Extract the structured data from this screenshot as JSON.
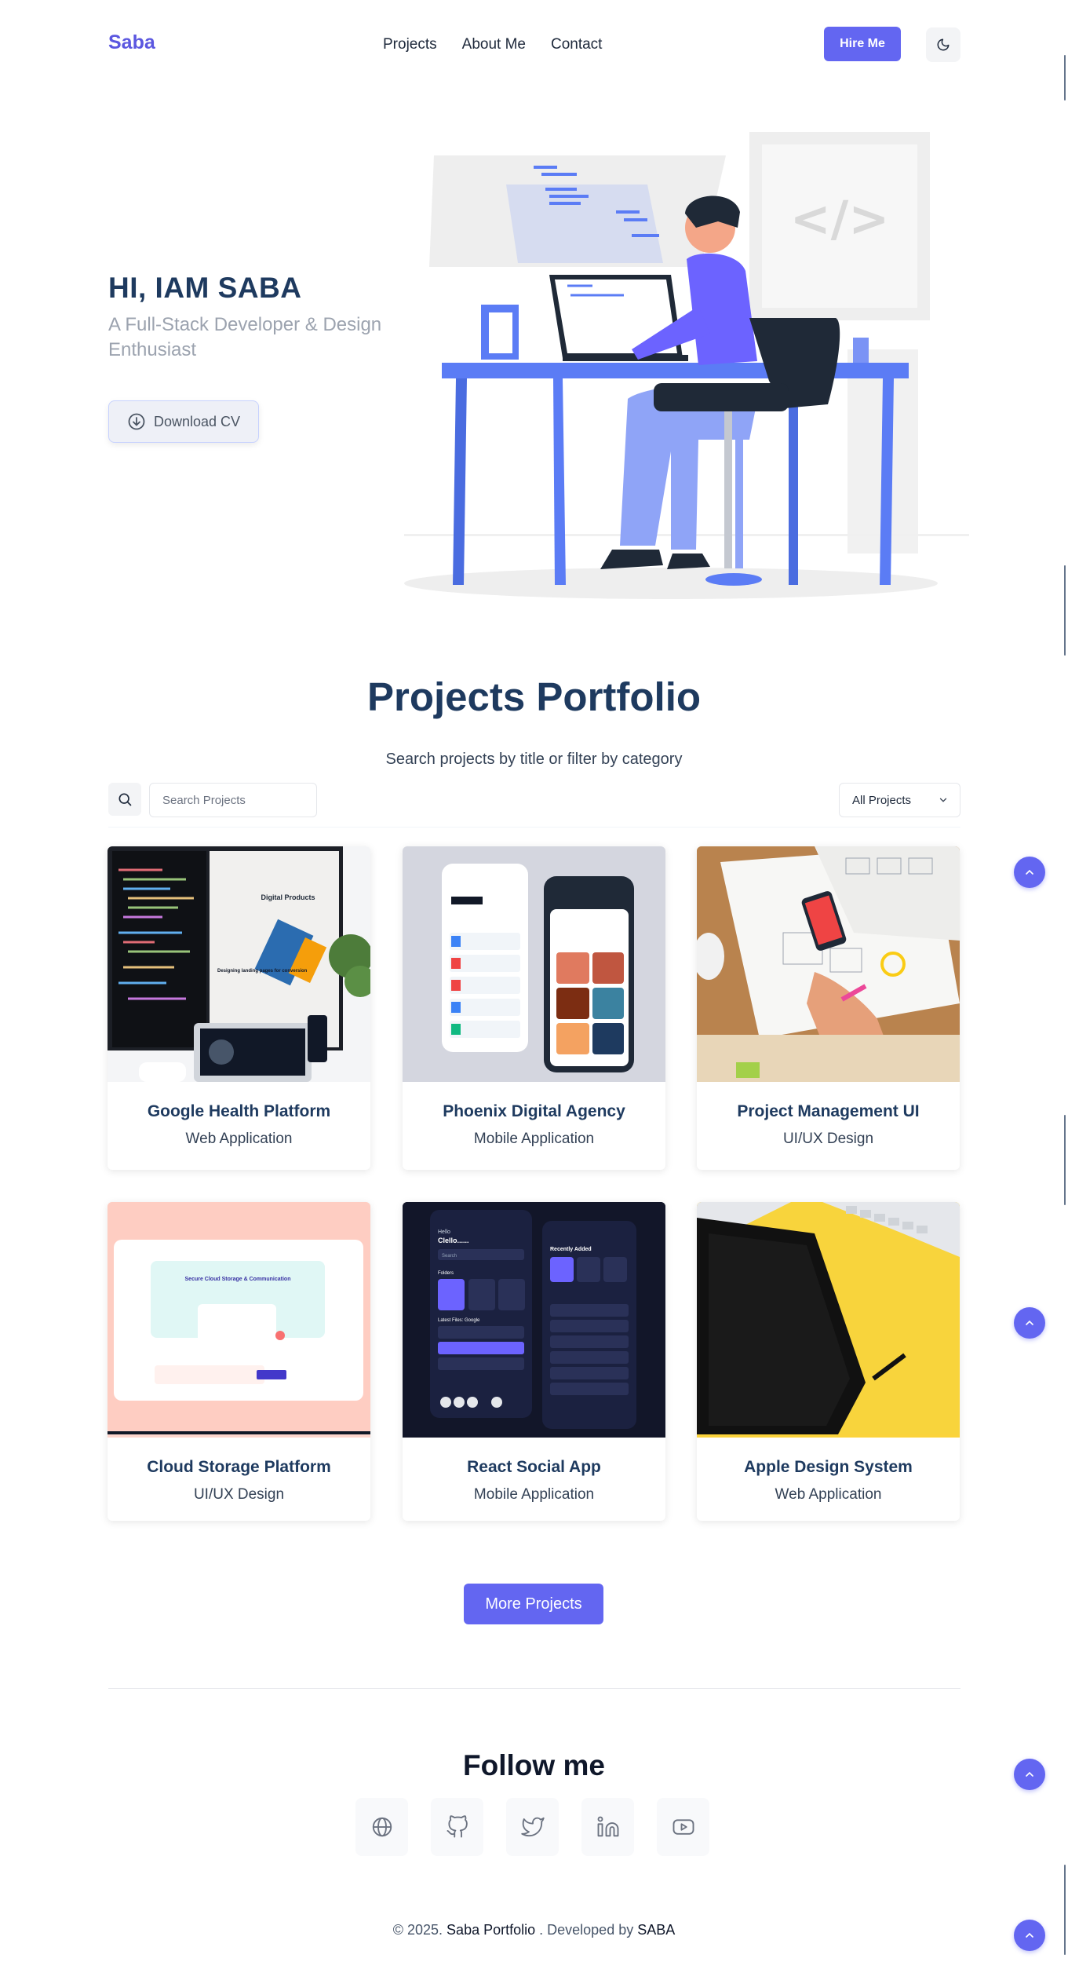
{
  "nav": {
    "logo": "Saba",
    "links": [
      "Projects",
      "About Me",
      "Contact"
    ],
    "hire_label": "Hire Me",
    "theme_icon": "moon-icon"
  },
  "hero": {
    "title": "HI, IAM SABA",
    "subtitle": "A Full-Stack Developer & Design Enthusiast",
    "cv_label": "Download CV",
    "illustration_text": "</>"
  },
  "projects": {
    "title": "Projects Portfolio",
    "subtitle": "Search projects by title or filter by category",
    "search_placeholder": "Search Projects",
    "filter_value": "All Projects",
    "cards": [
      {
        "title": "Google Health Platform",
        "category": "Web Application"
      },
      {
        "title": "Phoenix Digital Agency",
        "category": "Mobile Application"
      },
      {
        "title": "Project Management UI",
        "category": "UI/UX Design"
      },
      {
        "title": "Cloud Storage Platform",
        "category": "UI/UX Design"
      },
      {
        "title": "React Social App",
        "category": "Mobile Application"
      },
      {
        "title": "Apple Design System",
        "category": "Web Application"
      }
    ],
    "more_label": "More Projects"
  },
  "thumbs": {
    "c1_headline": "Designing landing pages for conversion",
    "c1_product": "Digital Products",
    "c4_headline": "Secure Cloud Storage & Communication",
    "c5_hello": "Hello",
    "c5_name": "Clello......",
    "c5_search": "Search",
    "c5_folders": "Folders",
    "c5_recent": "Recently Added",
    "c5_latest": "Latest Files: Google"
  },
  "footer": {
    "follow_title": "Follow me",
    "socials": [
      "globe-icon",
      "github-icon",
      "twitter-icon",
      "linkedin-icon",
      "youtube-icon"
    ],
    "copy_prefix": "© 2025.",
    "copy_brand": "Saba Portfolio",
    "copy_mid": ". Developed by",
    "copy_author": "SABA"
  },
  "colors": {
    "accent": "#6366f1",
    "heading": "#1e3a5f",
    "illustration_blue": "#5b7cf5"
  }
}
